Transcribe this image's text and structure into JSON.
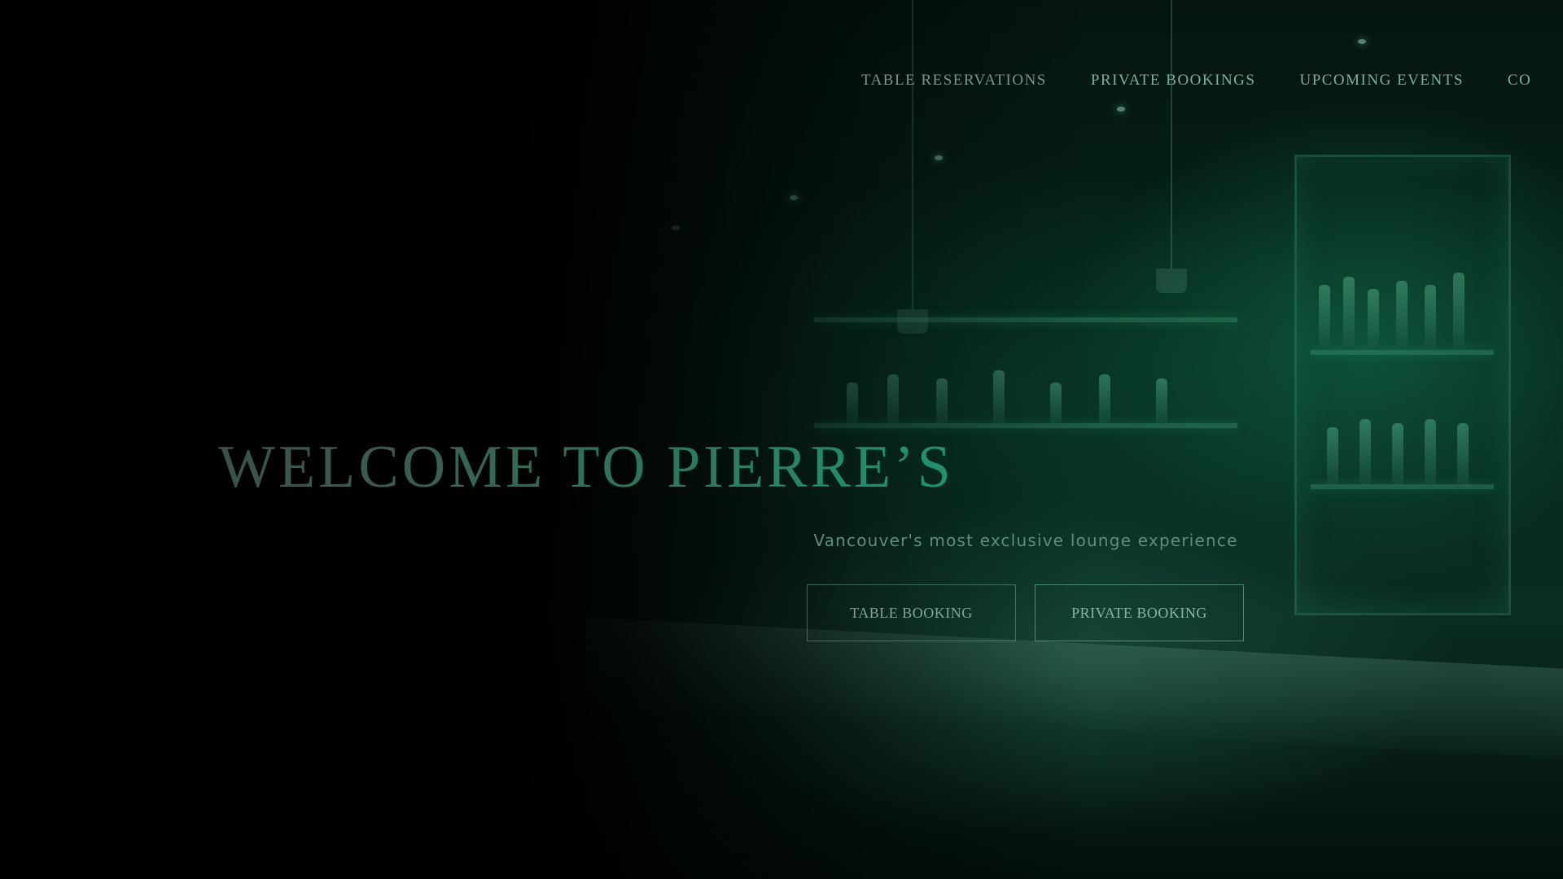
{
  "nav": {
    "items": [
      {
        "label": "TABLE RESERVATIONS"
      },
      {
        "label": "PRIVATE BOOKINGS"
      },
      {
        "label": "UPCOMING EVENTS"
      },
      {
        "label": "CO"
      }
    ]
  },
  "hero": {
    "title": "WELCOME TO PIERRE’S",
    "subtitle": "Vancouver's most exclusive lounge experience",
    "buttons": {
      "table_booking": "TABLE BOOKING",
      "private_booking": "PRIVATE BOOKING"
    }
  },
  "colors": {
    "background": "#000000",
    "accent_green": "#1f8f6e",
    "nav_text": "#7fae9c"
  }
}
